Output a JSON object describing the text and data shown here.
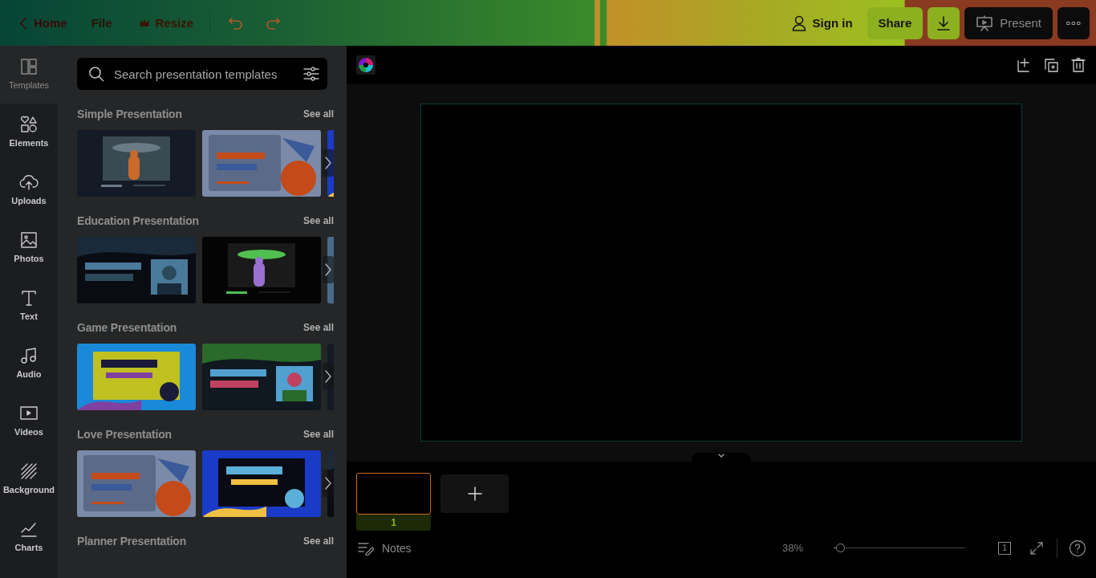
{
  "top_bar": {
    "left": [
      {
        "kind": "back",
        "label": "Home"
      },
      {
        "kind": "plain",
        "label": "File"
      },
      {
        "kind": "crown",
        "label": "Resize"
      },
      {
        "kind": "undo"
      },
      {
        "kind": "redo"
      }
    ],
    "right": [
      {
        "kind": "signin",
        "label": "Sign in"
      },
      {
        "kind": "share",
        "label": "Share"
      },
      {
        "kind": "download"
      },
      {
        "kind": "present",
        "label": "Present"
      },
      {
        "kind": "more"
      }
    ]
  },
  "sidebar": {
    "items": [
      {
        "kind": "templates",
        "label": "Templates",
        "selected": true
      },
      {
        "kind": "elements",
        "label": "Elements",
        "selected": false
      },
      {
        "kind": "uploads",
        "label": "Uploads",
        "selected": false
      },
      {
        "kind": "photos",
        "label": "Photos",
        "selected": false
      },
      {
        "kind": "text",
        "label": "Text",
        "selected": false
      },
      {
        "kind": "audio",
        "label": "Audio",
        "selected": false
      },
      {
        "kind": "videos",
        "label": "Videos",
        "selected": false
      },
      {
        "kind": "background",
        "label": "Background",
        "selected": false
      },
      {
        "kind": "charts",
        "label": "Charts",
        "selected": false
      }
    ]
  },
  "panel": {
    "search": {
      "placeholder": "Search presentation templates"
    },
    "sections": [
      {
        "title": "Simple Presentation",
        "see_all": "See all"
      },
      {
        "title": "Education Presentation",
        "see_all": "See all"
      },
      {
        "title": "Game Presentation",
        "see_all": "See all"
      },
      {
        "title": "Love Presentation",
        "see_all": "See all"
      },
      {
        "title": "Planner Presentation",
        "see_all": "See all"
      }
    ]
  },
  "editor": {
    "pages": [
      {
        "number": "1",
        "selected": true
      }
    ],
    "footer": {
      "notes": "Notes",
      "zoom": "38%",
      "zoom_slider": {
        "level": 0.05
      },
      "page_count": "1"
    }
  }
}
